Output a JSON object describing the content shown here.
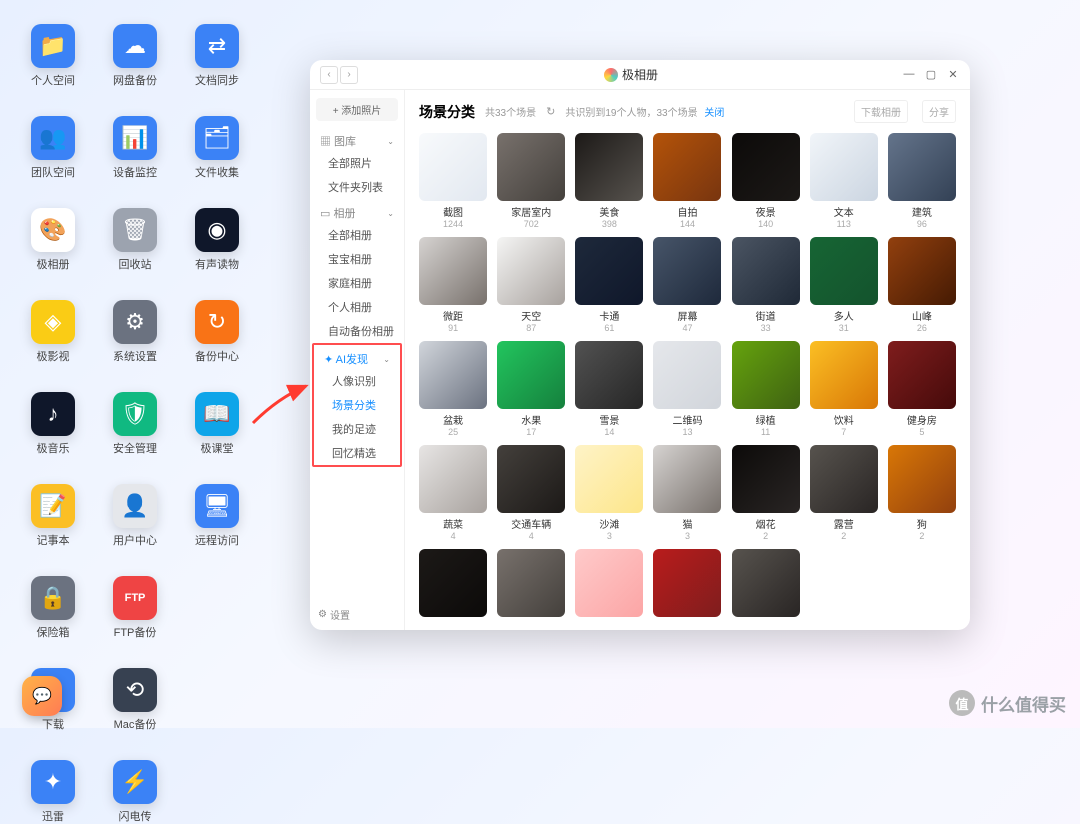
{
  "desktop": {
    "icons": [
      {
        "label": "个人空间",
        "bg": "#3b82f6",
        "glyph": "📁"
      },
      {
        "label": "网盘备份",
        "bg": "#3b82f6",
        "glyph": "☁"
      },
      {
        "label": "文档同步",
        "bg": "#3b82f6",
        "glyph": "⇄"
      },
      {
        "label": "团队空间",
        "bg": "#3b82f6",
        "glyph": "👥"
      },
      {
        "label": "设备监控",
        "bg": "#3b82f6",
        "glyph": "📊"
      },
      {
        "label": "文件收集",
        "bg": "#3b82f6",
        "glyph": "🗂"
      },
      {
        "label": "极相册",
        "bg": "#ffffff",
        "glyph": "🎨"
      },
      {
        "label": "回收站",
        "bg": "#9ca3af",
        "glyph": "🗑"
      },
      {
        "label": "有声读物",
        "bg": "#0f172a",
        "glyph": "◉"
      },
      {
        "label": "极影视",
        "bg": "#facc15",
        "glyph": "◈"
      },
      {
        "label": "系统设置",
        "bg": "#6b7280",
        "glyph": "⚙"
      },
      {
        "label": "备份中心",
        "bg": "#f97316",
        "glyph": "↻"
      },
      {
        "label": "极音乐",
        "bg": "#0f172a",
        "glyph": "♪"
      },
      {
        "label": "安全管理",
        "bg": "#10b981",
        "glyph": "🛡"
      },
      {
        "label": "极课堂",
        "bg": "#0ea5e9",
        "glyph": "📖"
      },
      {
        "label": "记事本",
        "bg": "#fbbf24",
        "glyph": "📝"
      },
      {
        "label": "用户中心",
        "bg": "#e5e7eb",
        "glyph": "👤"
      },
      {
        "label": "远程访问",
        "bg": "#3b82f6",
        "glyph": "🖥"
      },
      {
        "label": "保险箱",
        "bg": "#6b7280",
        "glyph": "🔒"
      },
      {
        "label": "FTP备份",
        "bg": "#ef4444",
        "glyph": "FTP"
      },
      {
        "label": "",
        "bg": "transparent",
        "glyph": ""
      },
      {
        "label": "下载",
        "bg": "#3b82f6",
        "glyph": "⬇"
      },
      {
        "label": "Mac备份",
        "bg": "#374151",
        "glyph": "⟲"
      },
      {
        "label": "",
        "bg": "transparent",
        "glyph": ""
      },
      {
        "label": "迅雷",
        "bg": "#3b82f6",
        "glyph": "✦"
      },
      {
        "label": "闪电传",
        "bg": "#3b82f6",
        "glyph": "⚡"
      }
    ]
  },
  "window": {
    "title": "极相册",
    "add_photo": "+ 添加照片",
    "sidebar": {
      "sections": [
        {
          "label": "图库",
          "icon": "▦",
          "items": [
            "全部照片",
            "文件夹列表"
          ]
        },
        {
          "label": "相册",
          "icon": "▭",
          "items": [
            "全部相册",
            "宝宝相册",
            "家庭相册",
            "个人相册",
            "自动备份相册"
          ]
        }
      ],
      "ai_section": {
        "label": "AI发现",
        "icon": "✦",
        "items": [
          "人像识别",
          "场景分类",
          "我的足迹",
          "回忆精选"
        ],
        "active_index": 1
      },
      "settings_label": "设置"
    },
    "header": {
      "title": "场景分类",
      "count_text": "共33个场景",
      "info_text": "共识别到19个人物，33个场景",
      "close_link": "关闭",
      "btn1": "下载相册",
      "btn2": "分享"
    },
    "tiles": [
      {
        "name": "截图",
        "count": "1244",
        "c1": "#f8fafc",
        "c2": "#e2e8f0"
      },
      {
        "name": "家居室内",
        "count": "702",
        "c1": "#78716c",
        "c2": "#44403c"
      },
      {
        "name": "美食",
        "count": "398",
        "c1": "#1c1917",
        "c2": "#57534e"
      },
      {
        "name": "自拍",
        "count": "144",
        "c1": "#b45309",
        "c2": "#78350f"
      },
      {
        "name": "夜景",
        "count": "140",
        "c1": "#0c0a09",
        "c2": "#1c1917"
      },
      {
        "name": "文本",
        "count": "113",
        "c1": "#f1f5f9",
        "c2": "#cbd5e1"
      },
      {
        "name": "建筑",
        "count": "96",
        "c1": "#64748b",
        "c2": "#334155"
      },
      {
        "name": "微距",
        "count": "91",
        "c1": "#d6d3d1",
        "c2": "#78716c"
      },
      {
        "name": "天空",
        "count": "87",
        "c1": "#f5f5f4",
        "c2": "#a8a29e"
      },
      {
        "name": "卡通",
        "count": "61",
        "c1": "#1e293b",
        "c2": "#0f172a"
      },
      {
        "name": "屏幕",
        "count": "47",
        "c1": "#475569",
        "c2": "#1e293b"
      },
      {
        "name": "街道",
        "count": "33",
        "c1": "#4b5563",
        "c2": "#1f2937"
      },
      {
        "name": "多人",
        "count": "31",
        "c1": "#166534",
        "c2": "#14532d"
      },
      {
        "name": "山峰",
        "count": "26",
        "c1": "#92400e",
        "c2": "#451a03"
      },
      {
        "name": "盆栽",
        "count": "25",
        "c1": "#d1d5db",
        "c2": "#6b7280"
      },
      {
        "name": "水果",
        "count": "17",
        "c1": "#22c55e",
        "c2": "#15803d"
      },
      {
        "name": "雪景",
        "count": "14",
        "c1": "#525252",
        "c2": "#262626"
      },
      {
        "name": "二维码",
        "count": "13",
        "c1": "#e5e7eb",
        "c2": "#d1d5db"
      },
      {
        "name": "绿植",
        "count": "11",
        "c1": "#65a30d",
        "c2": "#3f6212"
      },
      {
        "name": "饮料",
        "count": "7",
        "c1": "#fbbf24",
        "c2": "#d97706"
      },
      {
        "name": "健身房",
        "count": "5",
        "c1": "#7f1d1d",
        "c2": "#450a0a"
      },
      {
        "name": "蔬菜",
        "count": "4",
        "c1": "#e7e5e4",
        "c2": "#a8a29e"
      },
      {
        "name": "交通车辆",
        "count": "4",
        "c1": "#44403c",
        "c2": "#1c1917"
      },
      {
        "name": "沙滩",
        "count": "3",
        "c1": "#fef3c7",
        "c2": "#fde68a"
      },
      {
        "name": "猫",
        "count": "3",
        "c1": "#d6d3d1",
        "c2": "#78716c"
      },
      {
        "name": "烟花",
        "count": "2",
        "c1": "#0c0a09",
        "c2": "#292524"
      },
      {
        "name": "露营",
        "count": "2",
        "c1": "#57534e",
        "c2": "#292524"
      },
      {
        "name": "狗",
        "count": "2",
        "c1": "#d97706",
        "c2": "#92400e"
      },
      {
        "name": "",
        "count": "",
        "c1": "#1c1917",
        "c2": "#0c0a09"
      },
      {
        "name": "",
        "count": "",
        "c1": "#78716c",
        "c2": "#44403c"
      },
      {
        "name": "",
        "count": "",
        "c1": "#fecaca",
        "c2": "#fca5a5"
      },
      {
        "name": "",
        "count": "",
        "c1": "#b91c1c",
        "c2": "#7f1d1d"
      },
      {
        "name": "",
        "count": "",
        "c1": "#57534e",
        "c2": "#292524"
      }
    ]
  },
  "watermark": {
    "badge": "值",
    "text": "什么值得买"
  }
}
